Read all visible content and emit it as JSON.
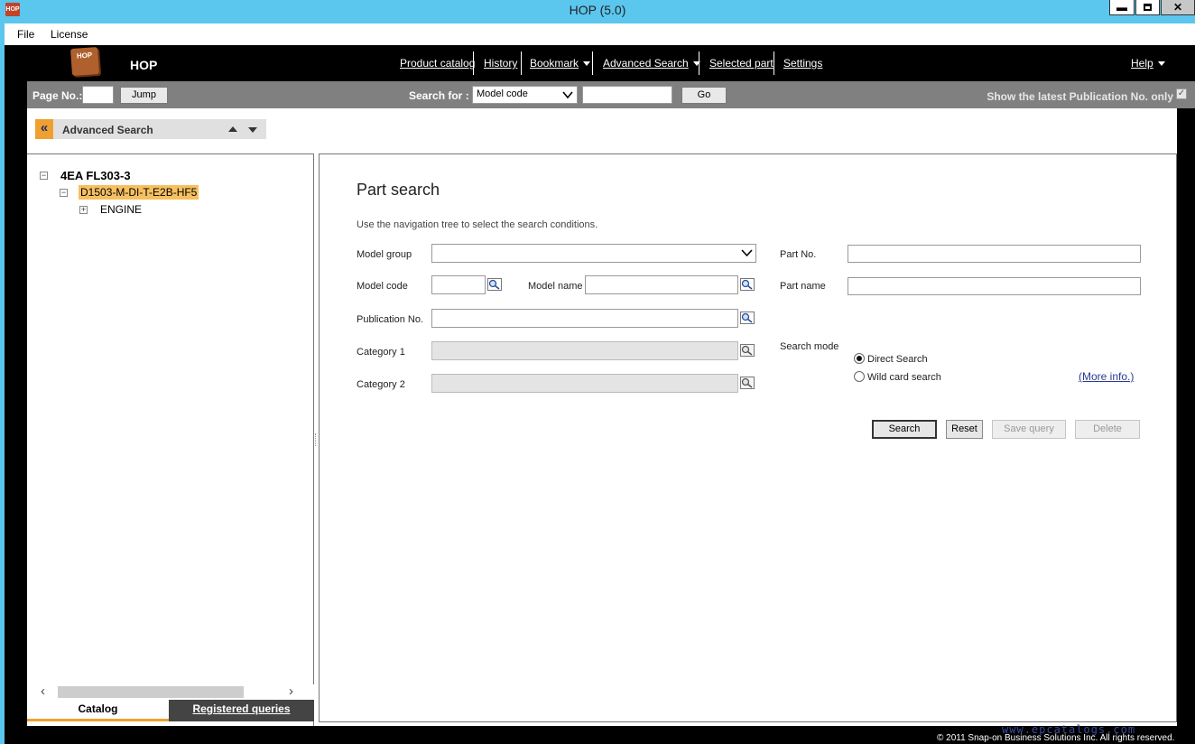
{
  "window": {
    "icon_text": "HOP",
    "title": "HOP (5.0)",
    "minimize": "▬",
    "close": "✕"
  },
  "menubar": {
    "file": "File",
    "license": "License"
  },
  "header": {
    "logo_text": "HOP",
    "app_name": "HOP",
    "nav": {
      "product_catalog": "Product catalog",
      "history": "History",
      "bookmark": "Bookmark",
      "advanced_search": "Advanced Search",
      "selected_part": "Selected part",
      "settings": "Settings",
      "help": "Help"
    }
  },
  "toolbar": {
    "page_no_label": "Page No.:",
    "page_no_value": "",
    "jump_label": "Jump",
    "search_for_label": "Search for :",
    "search_for_selected": "Model code",
    "search_for_value": "",
    "go_label": "Go",
    "show_latest_label": "Show the latest Publication No. only",
    "show_latest_checked": true
  },
  "advanced_panel": {
    "collapse_glyph": "«",
    "title": "Advanced Search"
  },
  "tree": {
    "root": "4EA FL303-3",
    "child": "D1503-M-DI-T-E2B-HF5",
    "grandchild": "ENGINE"
  },
  "tabs": {
    "catalog": "Catalog",
    "registered_queries": "Registered queries"
  },
  "part_search": {
    "title": "Part search",
    "hint": "Use the navigation tree to select the search conditions.",
    "model_group_label": "Model group",
    "model_code_label": "Model code",
    "model_name_label": "Model name",
    "publication_no_label": "Publication No.",
    "category1_label": "Category 1",
    "category2_label": "Category 2",
    "part_no_label": "Part No.",
    "part_name_label": "Part name",
    "search_mode_label": "Search mode",
    "mode_direct": "Direct Search",
    "mode_wildcard": "Wild card search",
    "selected_mode": "Direct Search",
    "more_info": "(More info.)",
    "buttons": {
      "search": "Search",
      "reset": "Reset",
      "save_query": "Save query",
      "delete": "Delete"
    }
  },
  "footer": {
    "watermark": "www.epcatalogs.com",
    "copyright": "© 2011 Snap-on Business Solutions Inc. All rights reserved."
  },
  "colors": {
    "titlebar": "#5bc6ee",
    "accent": "#f0a030",
    "toolbar": "#808080"
  }
}
